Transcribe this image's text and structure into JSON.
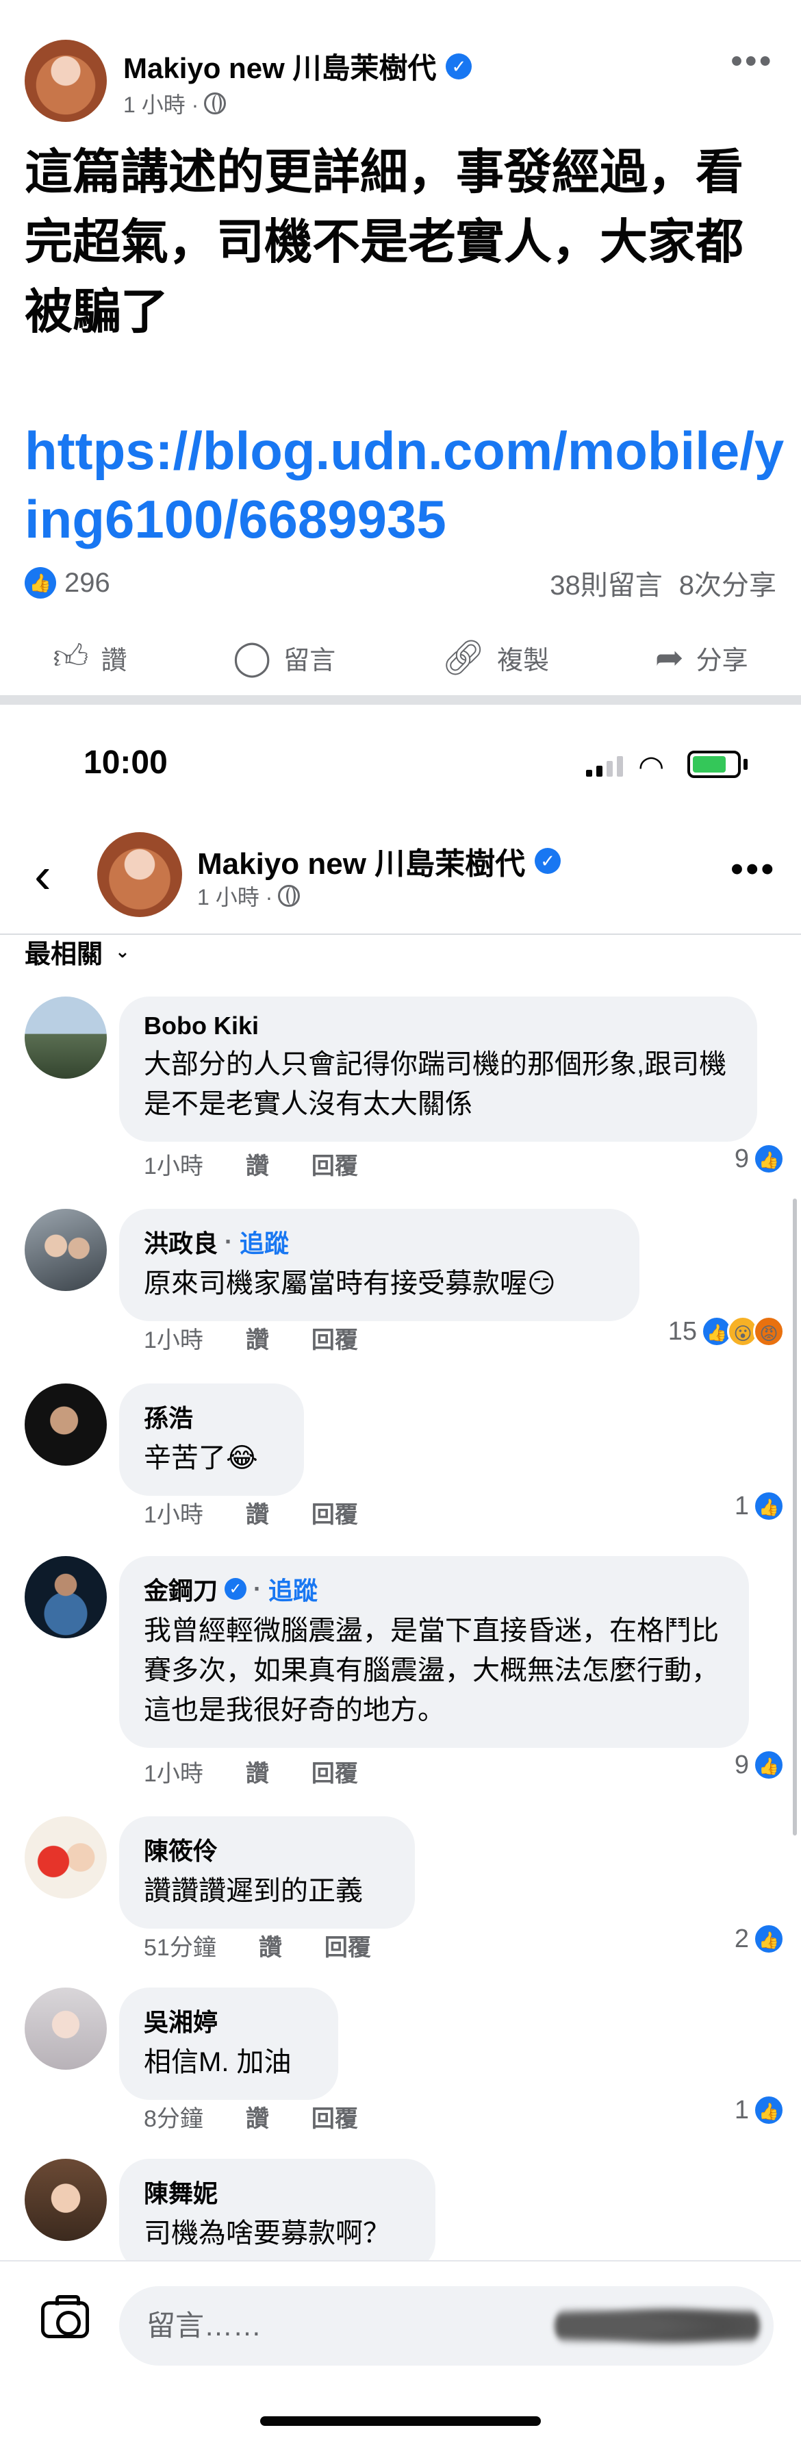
{
  "post": {
    "author": "Makiyo new 川島茉樹代",
    "time": "1 小時 ·",
    "text": "這篇講述的更詳細，事發經過，看完超氣，司機不是老實人，大家都被騙了",
    "link": "https://blog.udn.com/mobile/ying6100/6689935",
    "likes": "296",
    "comments": "38則留言",
    "shares": "8次分享",
    "actions": {
      "like": "讚",
      "comment": "留言",
      "copy": "複製",
      "share": "分享"
    }
  },
  "status_bar": {
    "time": "10:00"
  },
  "nav": {
    "author": "Makiyo new 川島茉樹代",
    "time": "1 小時 ·"
  },
  "sort_label": "最相關",
  "comments": [
    {
      "name": "Bobo Kiki",
      "text": "大部分的人只會記得你踹司機的那個形象,跟司機是不是老實人沒有太大關係",
      "time": "1小時",
      "like": "讚",
      "reply": "回覆",
      "reactions": "9"
    },
    {
      "name": "洪政良",
      "follow": "追蹤",
      "text": "原來司機家屬當時有接受募款喔😏",
      "time": "1小時",
      "like": "讚",
      "reply": "回覆",
      "reactions": "15"
    },
    {
      "name": "孫浩",
      "text": "辛苦了😂",
      "time": "1小時",
      "like": "讚",
      "reply": "回覆",
      "reactions": "1"
    },
    {
      "name": "金鋼刀",
      "follow": "追蹤",
      "text": "我曾經輕微腦震盪，是當下直接昏迷，在格鬥比賽多次，如果真有腦震盪，大概無法怎麼行動，這也是我很好奇的地方。",
      "time": "1小時",
      "like": "讚",
      "reply": "回覆",
      "reactions": "9"
    },
    {
      "name": "陳筱伶",
      "text": "讚讚讚遲到的正義",
      "time": "51分鐘",
      "like": "讚",
      "reply": "回覆",
      "reactions": "2"
    },
    {
      "name": "吳湘婷",
      "text": "相信M. 加油",
      "time": "8分鐘",
      "like": "讚",
      "reply": "回覆",
      "reactions": "1"
    },
    {
      "name": "陳舞妮",
      "text": "司機為啥要募款啊？"
    }
  ],
  "input": {
    "placeholder": "留言……"
  },
  "colors": {
    "accent": "#1877f2",
    "muted": "#65676b",
    "bubble": "#f0f2f5"
  }
}
